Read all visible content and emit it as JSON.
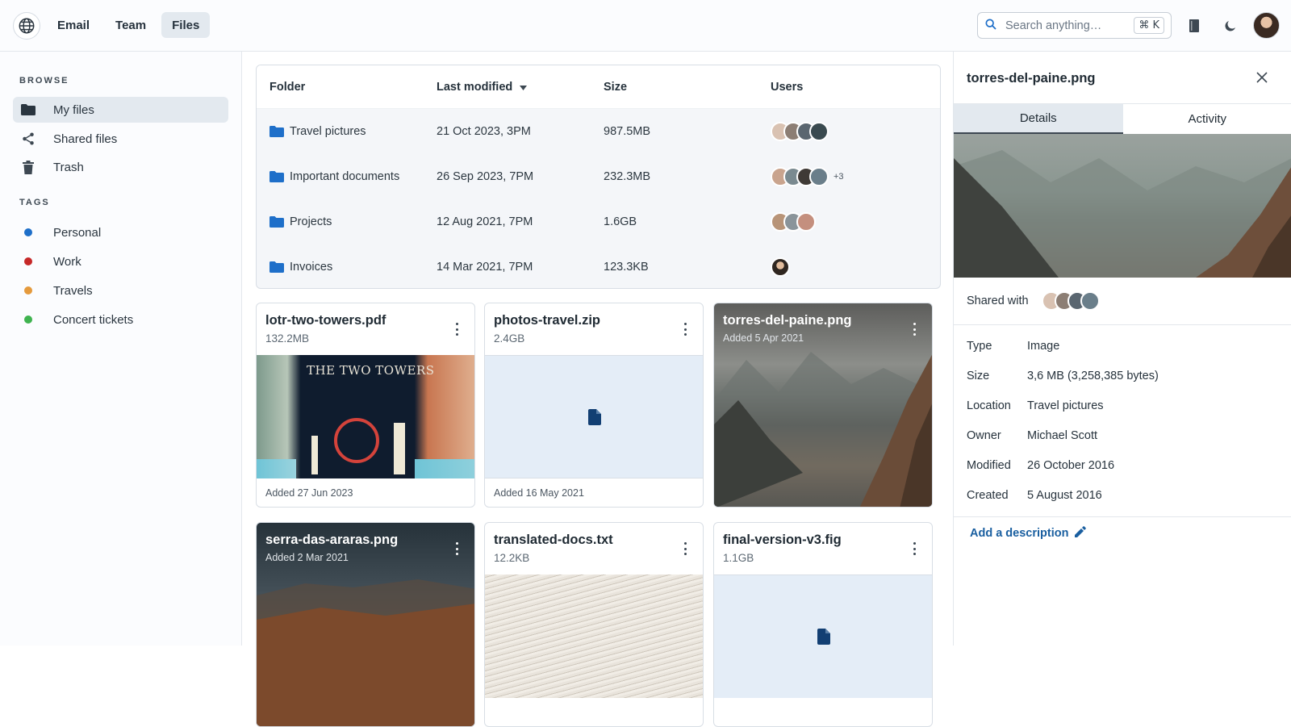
{
  "header": {
    "nav": [
      {
        "label": "Email",
        "active": false
      },
      {
        "label": "Team",
        "active": false
      },
      {
        "label": "Files",
        "active": true
      }
    ],
    "search": {
      "placeholder": "Search anything…",
      "shortcut": "⌘ K"
    },
    "icons": [
      "globe-icon",
      "book-icon",
      "moon-icon",
      "search-icon"
    ]
  },
  "sidebar": {
    "browse_title": "BROWSE",
    "browse": [
      {
        "label": "My files",
        "icon": "folder-icon",
        "active": true
      },
      {
        "label": "Shared files",
        "icon": "share-icon"
      },
      {
        "label": "Trash",
        "icon": "trash-icon"
      }
    ],
    "tags_title": "TAGS",
    "tags": [
      {
        "label": "Personal",
        "color": "#1e6fc9"
      },
      {
        "label": "Work",
        "color": "#c62828"
      },
      {
        "label": "Travels",
        "color": "#e59a3c"
      },
      {
        "label": "Concert tickets",
        "color": "#3fb34f"
      }
    ]
  },
  "table": {
    "headers": {
      "folder": "Folder",
      "modified": "Last modified",
      "size": "Size",
      "users": "Users"
    },
    "rows": [
      {
        "folder": "Travel pictures",
        "modified": "21 Oct 2023, 3PM",
        "size": "987.5MB",
        "users": 4,
        "more": ""
      },
      {
        "folder": "Important documents",
        "modified": "26 Sep 2023, 7PM",
        "size": "232.3MB",
        "users": 4,
        "more": "+3"
      },
      {
        "folder": "Projects",
        "modified": "12 Aug 2021, 7PM",
        "size": "1.6GB",
        "users": 3,
        "more": ""
      },
      {
        "folder": "Invoices",
        "modified": "14 Mar 2021, 7PM",
        "size": "123.3KB",
        "users": 1,
        "more": ""
      }
    ]
  },
  "cards": [
    {
      "title": "lotr-two-towers.pdf",
      "sub": "132.2MB",
      "foot": "Added 27 Jun 2023",
      "media": "The Two Towers book",
      "book_title": "THE TWO TOWERS"
    },
    {
      "title": "photos-travel.zip",
      "sub": "2.4GB",
      "foot": "Added 16 May 2021",
      "media": "file placeholder"
    },
    {
      "title": "torres-del-paine.png",
      "sub": "Added 5 Apr 2021",
      "media": "mountain photo"
    },
    {
      "title": "serra-das-araras.png",
      "sub": "Added 2 Mar 2021",
      "media": "mountain photo"
    },
    {
      "title": "translated-docs.txt",
      "sub": "12.2KB",
      "media": "paper documents"
    },
    {
      "title": "final-version-v3.fig",
      "sub": "1.1GB",
      "media": "file placeholder"
    }
  ],
  "panel": {
    "title": "torres-del-paine.png",
    "tabs": [
      "Details",
      "Activity"
    ],
    "shared_label": "Shared with",
    "meta": [
      {
        "k": "Type",
        "v": "Image"
      },
      {
        "k": "Size",
        "v": "3,6 MB (3,258,385 bytes)"
      },
      {
        "k": "Location",
        "v": "Travel pictures"
      },
      {
        "k": "Owner",
        "v": "Michael Scott"
      },
      {
        "k": "Modified",
        "v": "26 October 2016"
      },
      {
        "k": "Created",
        "v": "5 August 2016"
      }
    ],
    "add_description": "Add a description"
  }
}
